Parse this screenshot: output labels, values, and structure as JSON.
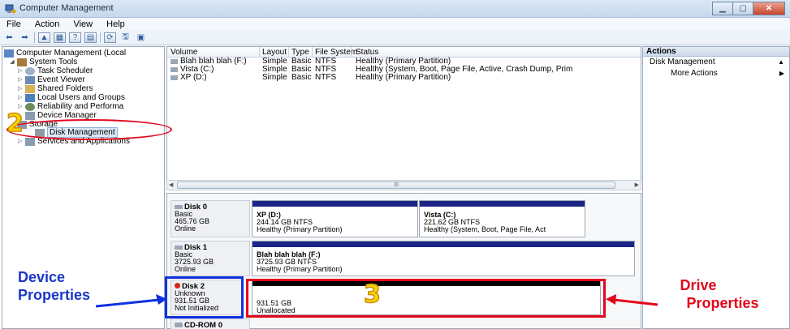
{
  "window": {
    "title": "Computer Management"
  },
  "menu": [
    "File",
    "Action",
    "View",
    "Help"
  ],
  "tree": {
    "root": "Computer Management (Local",
    "system_tools": "System Tools",
    "items": [
      "Task Scheduler",
      "Event Viewer",
      "Shared Folders",
      "Local Users and Groups",
      "Reliability and Performa",
      "Device Manager"
    ],
    "storage": "Storage",
    "disk_management": "Disk Management",
    "services": "Services and Applications"
  },
  "volume_list": {
    "headers": [
      "Volume",
      "Layout",
      "Type",
      "File System",
      "Status"
    ],
    "rows": [
      [
        "Blah blah blah (F:)",
        "Simple",
        "Basic",
        "NTFS",
        "Healthy (Primary Partition)"
      ],
      [
        "Vista (C:)",
        "Simple",
        "Basic",
        "NTFS",
        "Healthy (System, Boot, Page File, Active, Crash Dump, Prim"
      ],
      [
        "XP (D:)",
        "Simple",
        "Basic",
        "NTFS",
        "Healthy (Primary Partition)"
      ]
    ],
    "scroll_thumb": "III"
  },
  "disks": [
    {
      "name": "Disk 0",
      "type": "Basic",
      "size": "465.76 GB",
      "status": "Online"
    },
    {
      "name": "Disk 1",
      "type": "Basic",
      "size": "3725.93 GB",
      "status": "Online"
    },
    {
      "name": "Disk 2",
      "type": "Unknown",
      "size": "931.51 GB",
      "status": "Not Initialized"
    },
    {
      "name": "CD-ROM 0"
    }
  ],
  "partitions": {
    "xp": {
      "name": "XP  (D:)",
      "size": "244.14 GB NTFS",
      "status": "Healthy (Primary Partition)"
    },
    "vista": {
      "name": "Vista  (C:)",
      "size": "221.62 GB NTFS",
      "status": "Healthy (System, Boot, Page File, Act"
    },
    "blah": {
      "name": "Blah blah blah  (F:)",
      "size": "3725.93 GB NTFS",
      "status": "Healthy (Primary Partition)"
    },
    "unalloc": {
      "size": "931.51 GB",
      "status": "Unallocated"
    }
  },
  "actions": {
    "header": "Actions",
    "section": "Disk Management",
    "more": "More Actions"
  },
  "annotations": {
    "num2": "2",
    "num3": "3",
    "device_line1": "Device",
    "device_line2": "Properties",
    "drive_line1": "Drive",
    "drive_line2": "Properties",
    "colors": {
      "red": "#e3061b",
      "blue": "#1031e0",
      "label_blue": "#1a37c9",
      "label_red": "#e3061b"
    }
  }
}
